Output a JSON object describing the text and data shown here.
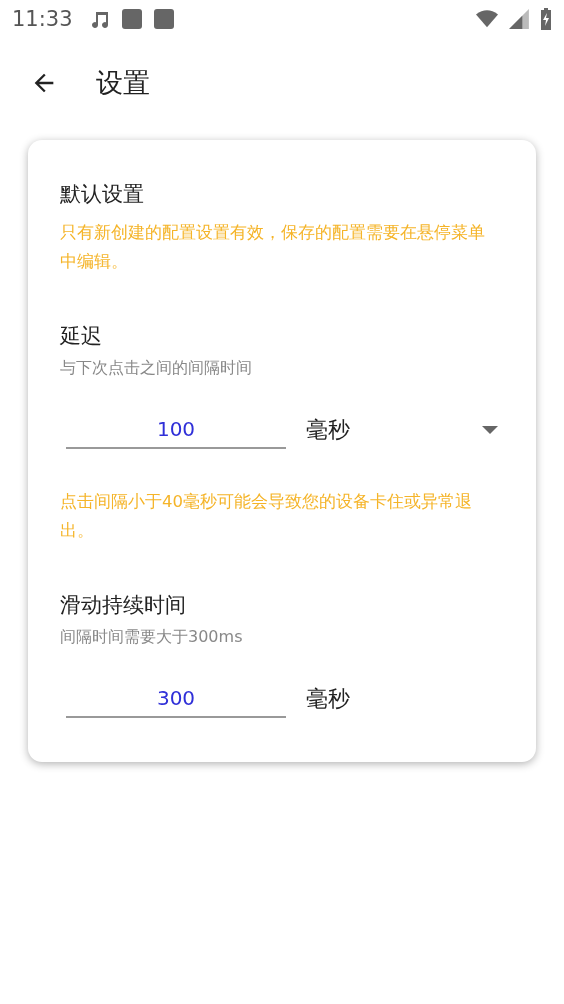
{
  "status_bar": {
    "time": "11:33"
  },
  "app_bar": {
    "title": "设置"
  },
  "card": {
    "title": "默认设置",
    "note": "只有新创建的配置设置有效，保存的配置需要在悬停菜单中编辑。",
    "sections": [
      {
        "title": "延迟",
        "subtitle": "与下次点击之间的间隔时间",
        "value": "100",
        "unit": "毫秒",
        "has_dropdown": true,
        "warning": "点击间隔小于40毫秒可能会导致您的设备卡住或异常退出。"
      },
      {
        "title": "滑动持续时间",
        "subtitle": "间隔时间需要大于300ms",
        "value": "300",
        "unit": "毫秒",
        "has_dropdown": false
      }
    ]
  }
}
